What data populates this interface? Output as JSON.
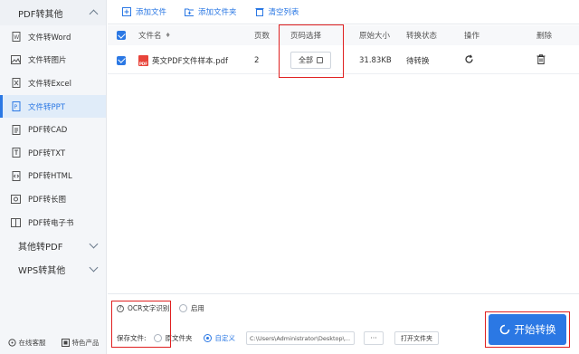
{
  "sidebar": {
    "group_pdf": "PDF转其他",
    "items": [
      {
        "label": "文件转Word",
        "icon": "word-file-icon"
      },
      {
        "label": "文件转图片",
        "icon": "image-icon"
      },
      {
        "label": "文件转Excel",
        "icon": "excel-file-icon"
      },
      {
        "label": "文件转PPT",
        "icon": "ppt-file-icon"
      },
      {
        "label": "PDF转CAD",
        "icon": "cad-file-icon"
      },
      {
        "label": "PDF转TXT",
        "icon": "txt-file-icon"
      },
      {
        "label": "PDF转HTML",
        "icon": "html-file-icon"
      },
      {
        "label": "PDF转长图",
        "icon": "long-image-icon"
      },
      {
        "label": "PDF转电子书",
        "icon": "ebook-icon"
      }
    ],
    "active_index": 3,
    "group_other": "其他转PDF",
    "group_wps": "WPS转其他",
    "footer": {
      "service": "在线客服",
      "products": "特色产品"
    }
  },
  "toolbar": {
    "add_file": "添加文件",
    "add_folder": "添加文件夹",
    "clear_list": "清空列表"
  },
  "table": {
    "headers": {
      "name": "文件名",
      "pages": "页数",
      "range": "页码选择",
      "size": "原始大小",
      "status": "转换状态",
      "op": "操作",
      "del": "删除"
    },
    "rows": [
      {
        "name": "英文PDF文件样本.pdf",
        "pages": "2",
        "range": "全部",
        "size": "31.83KB",
        "status": "待转换"
      }
    ]
  },
  "bottom": {
    "ocr_label": "OCR文字识别:",
    "ocr_enable": "启用",
    "save_label": "保存文件:",
    "save_original": "原文件夹",
    "save_custom": "自定义",
    "path": "C:\\Users\\Administrator\\Desktop\\...",
    "more": "···",
    "open_folder": "打开文件夹"
  },
  "start_button": "开始转换",
  "colors": {
    "accent": "#2b78e4",
    "highlight": "#e02020",
    "pdf_red": "#e8443a"
  }
}
